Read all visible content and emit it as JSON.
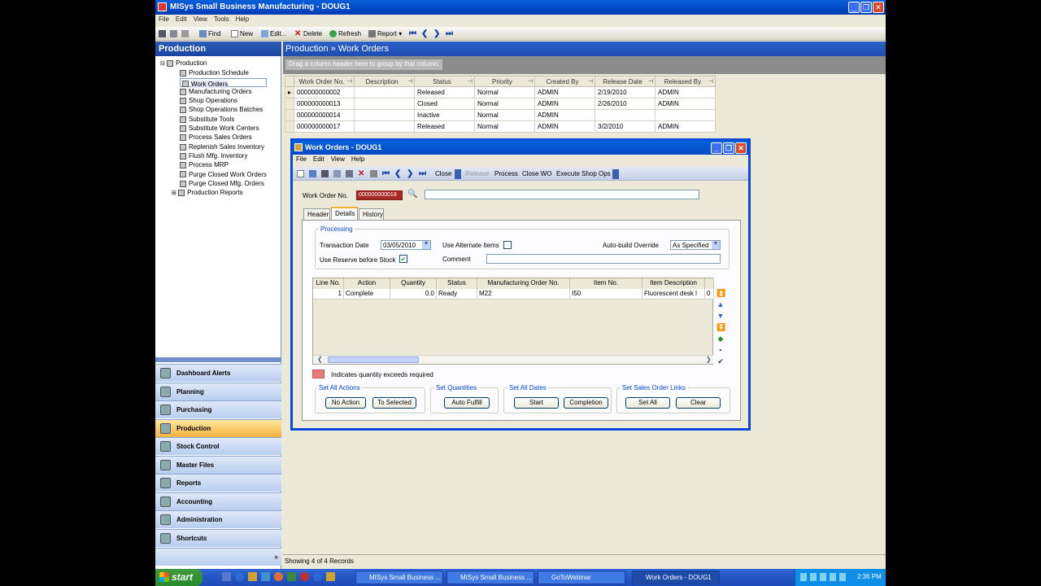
{
  "app": {
    "title": "MISys Small Business Manufacturing - DOUG1",
    "menu": [
      "File",
      "Edit",
      "View",
      "Tools",
      "Help"
    ],
    "toolbar": {
      "find": "Find",
      "new": "New",
      "edit": "Edit...",
      "delete": "Delete",
      "refresh": "Refresh",
      "report": "Report"
    }
  },
  "sidebar": {
    "header": "Production",
    "tree_root": "Production",
    "tree_items": [
      "Production Schedule",
      "Work Orders",
      "Manufacturing Orders",
      "Shop Operations",
      "Shop Operations Batches",
      "Substitute Tools",
      "Substitute Work Centers",
      "Process Sales Orders",
      "Replenish Sales Inventory",
      "Flush Mfg. Inventory",
      "Process MRP",
      "Purge Closed Work Orders",
      "Purge Closed Mfg. Orders"
    ],
    "tree_reports": "Production Reports",
    "nav": [
      "Dashboard Alerts",
      "Planning",
      "Purchasing",
      "Production",
      "Stock Control",
      "Master Files",
      "Reports",
      "Accounting",
      "Administration",
      "Shortcuts"
    ]
  },
  "main": {
    "header": "Production » Work Orders",
    "group_hint": "Drag a column header here to group by that column.",
    "columns": [
      "Work Order No.",
      "Description",
      "Status",
      "Priority",
      "Created By",
      "Release Date",
      "Released By"
    ],
    "rows": [
      [
        "000000000002",
        "",
        "Released",
        "Normal",
        "ADMIN",
        "2/19/2010",
        "ADMIN"
      ],
      [
        "000000000013",
        "",
        "Closed",
        "Normal",
        "ADMIN",
        "2/26/2010",
        "ADMIN"
      ],
      [
        "000000000014",
        "",
        "Inactive",
        "Normal",
        "ADMIN",
        "",
        ""
      ],
      [
        "000000000017",
        "",
        "Released",
        "Normal",
        "ADMIN",
        "3/2/2010",
        "ADMIN"
      ]
    ],
    "status": "Showing 4 of 4 Records"
  },
  "dialog": {
    "title": "Work Orders - DOUG1",
    "menu": [
      "File",
      "Edit",
      "View",
      "Help"
    ],
    "toolbar": {
      "close": "Close",
      "release": "Release",
      "process": "Process",
      "close_wo": "Close WO",
      "execute": "Execute Shop Ops"
    },
    "wo_label": "Work Order No.",
    "wo_value": "000000000018",
    "tabs": [
      "Header",
      "Details",
      "History"
    ],
    "processing": {
      "group": "Processing",
      "transaction_date_label": "Transaction Date",
      "transaction_date": "03/05/2010",
      "use_alternate_label": "Use Alternate Items",
      "autobuild_label": "Auto-build Override",
      "autobuild_value": "As Specified",
      "reserve_label": "Use Reserve before Stock",
      "comment_label": "Comment"
    },
    "grid": {
      "columns": [
        "Line No.",
        "Action",
        "Quantity",
        "Status",
        "Manufacturing Order No.",
        "Item No.",
        "Item Description"
      ],
      "row": [
        "1",
        "Complete",
        "0.0",
        "Ready",
        "M22",
        "I50",
        "Fluorescent desk l",
        "0"
      ]
    },
    "legend": "Indicates quantity exceeds required",
    "groups": {
      "set_all_actions": "Set All Actions",
      "no_action": "No Action",
      "to_selected": "To Selected",
      "set_quantities": "Set Quantities",
      "auto_fulfill": "Auto Fulfill",
      "set_all_dates": "Set All Dates",
      "start": "Start",
      "completion": "Completion",
      "set_links": "Set Sales Order Links",
      "set_all": "Set All",
      "clear": "Clear"
    }
  },
  "taskbar": {
    "start": "start",
    "items": [
      "MISys Small Business ...",
      "MISys Small Business ...",
      "GoToWebinar",
      "Work Orders - DOUG1"
    ],
    "clock": "2:36 PM"
  },
  "colors": {
    "accent": "#0a4ad8",
    "nav_active": "#f6b23e",
    "wo_highlight": "#a82a28",
    "legend_swatch": "#e87a7a"
  }
}
